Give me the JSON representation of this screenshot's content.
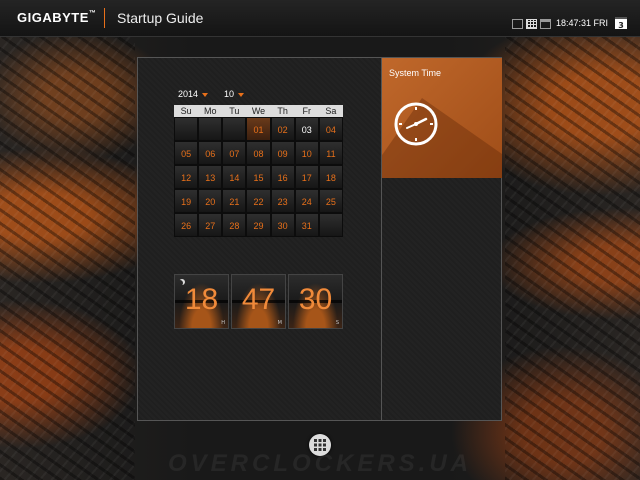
{
  "header": {
    "brand": "GIGABYTE",
    "brand_mark": "™",
    "title": "Startup Guide",
    "icons": [
      "hd-icon",
      "grid-view-icon",
      "window-icon"
    ],
    "time": "18:47:31 FRI",
    "day_number": "3"
  },
  "calendar": {
    "year": "2014",
    "month": "10",
    "weekdays": [
      "Su",
      "Mo",
      "Tu",
      "We",
      "Th",
      "Fr",
      "Sa"
    ],
    "days": [
      "",
      "",
      "",
      "01",
      "02",
      "03",
      "04",
      "05",
      "06",
      "07",
      "08",
      "09",
      "10",
      "11",
      "12",
      "13",
      "14",
      "15",
      "16",
      "17",
      "18",
      "19",
      "20",
      "21",
      "22",
      "23",
      "24",
      "25",
      "26",
      "27",
      "28",
      "29",
      "30",
      "31",
      ""
    ],
    "selected_day": "01",
    "today": "03"
  },
  "clock": {
    "hours": "18",
    "minutes": "47",
    "seconds": "30",
    "hours_unit": "H",
    "minutes_unit": "M",
    "seconds_unit": "S"
  },
  "tile": {
    "label": "System Time",
    "icon": "clock-icon"
  },
  "footer": {
    "apps_icon": "apps-grid-icon",
    "watermark": "OVERCLOCKERS.UA"
  },
  "colors": {
    "accent": "#e8701a",
    "tile": "#b35c22"
  }
}
